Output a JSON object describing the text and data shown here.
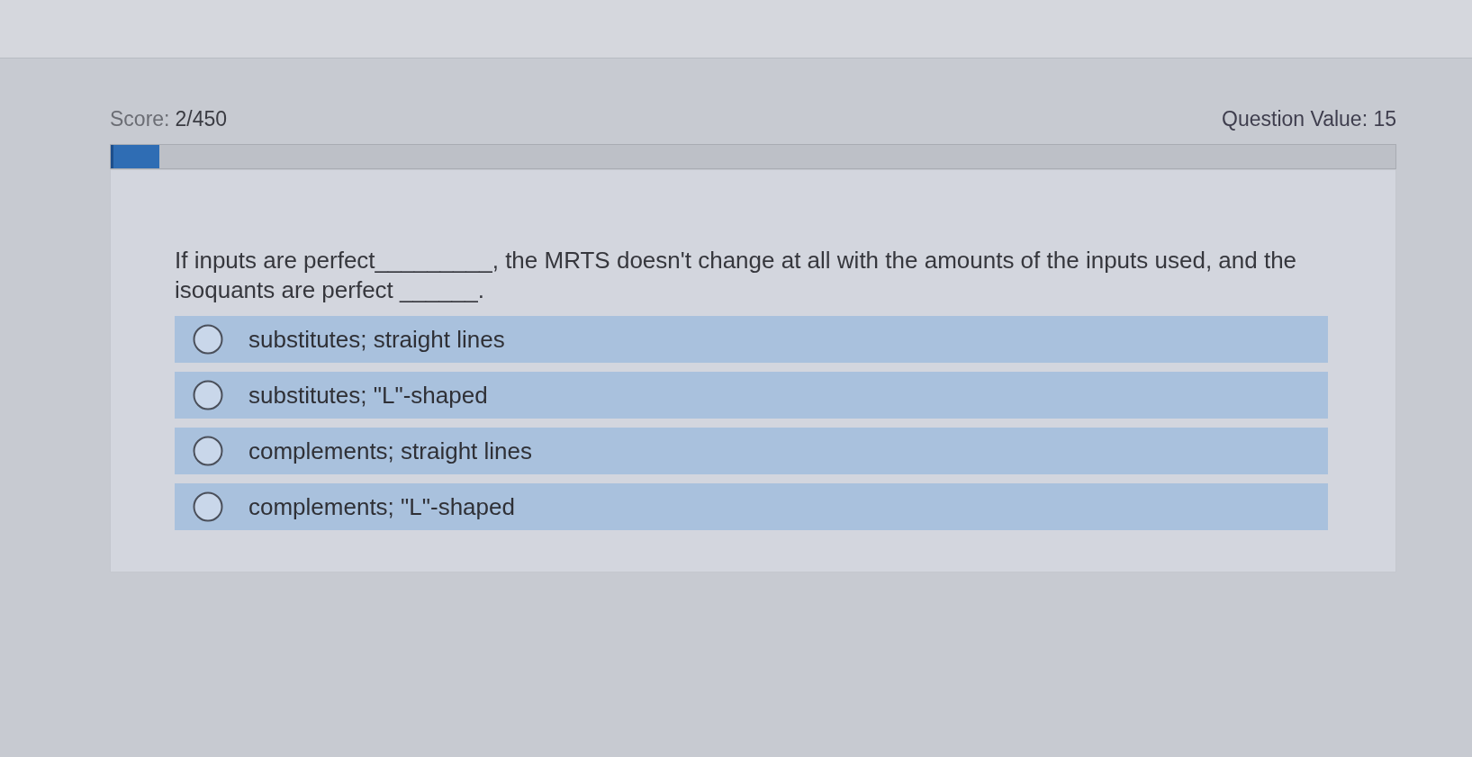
{
  "header": {
    "score_label": "Score:",
    "score_value": "2/450",
    "question_value": "Question Value: 15"
  },
  "progress": {
    "level": 0.038
  },
  "question": {
    "text": "If inputs are perfect_________, the MRTS doesn't change at all with the amounts of the inputs used, and the isoquants are perfect ______."
  },
  "options": [
    {
      "label": "substitutes; straight lines",
      "selected": false
    },
    {
      "label": "substitutes; \"L\"-shaped",
      "selected": false
    },
    {
      "label": "complements; straight lines",
      "selected": false
    },
    {
      "label": "complements; \"L\"-shaped",
      "selected": false
    }
  ]
}
